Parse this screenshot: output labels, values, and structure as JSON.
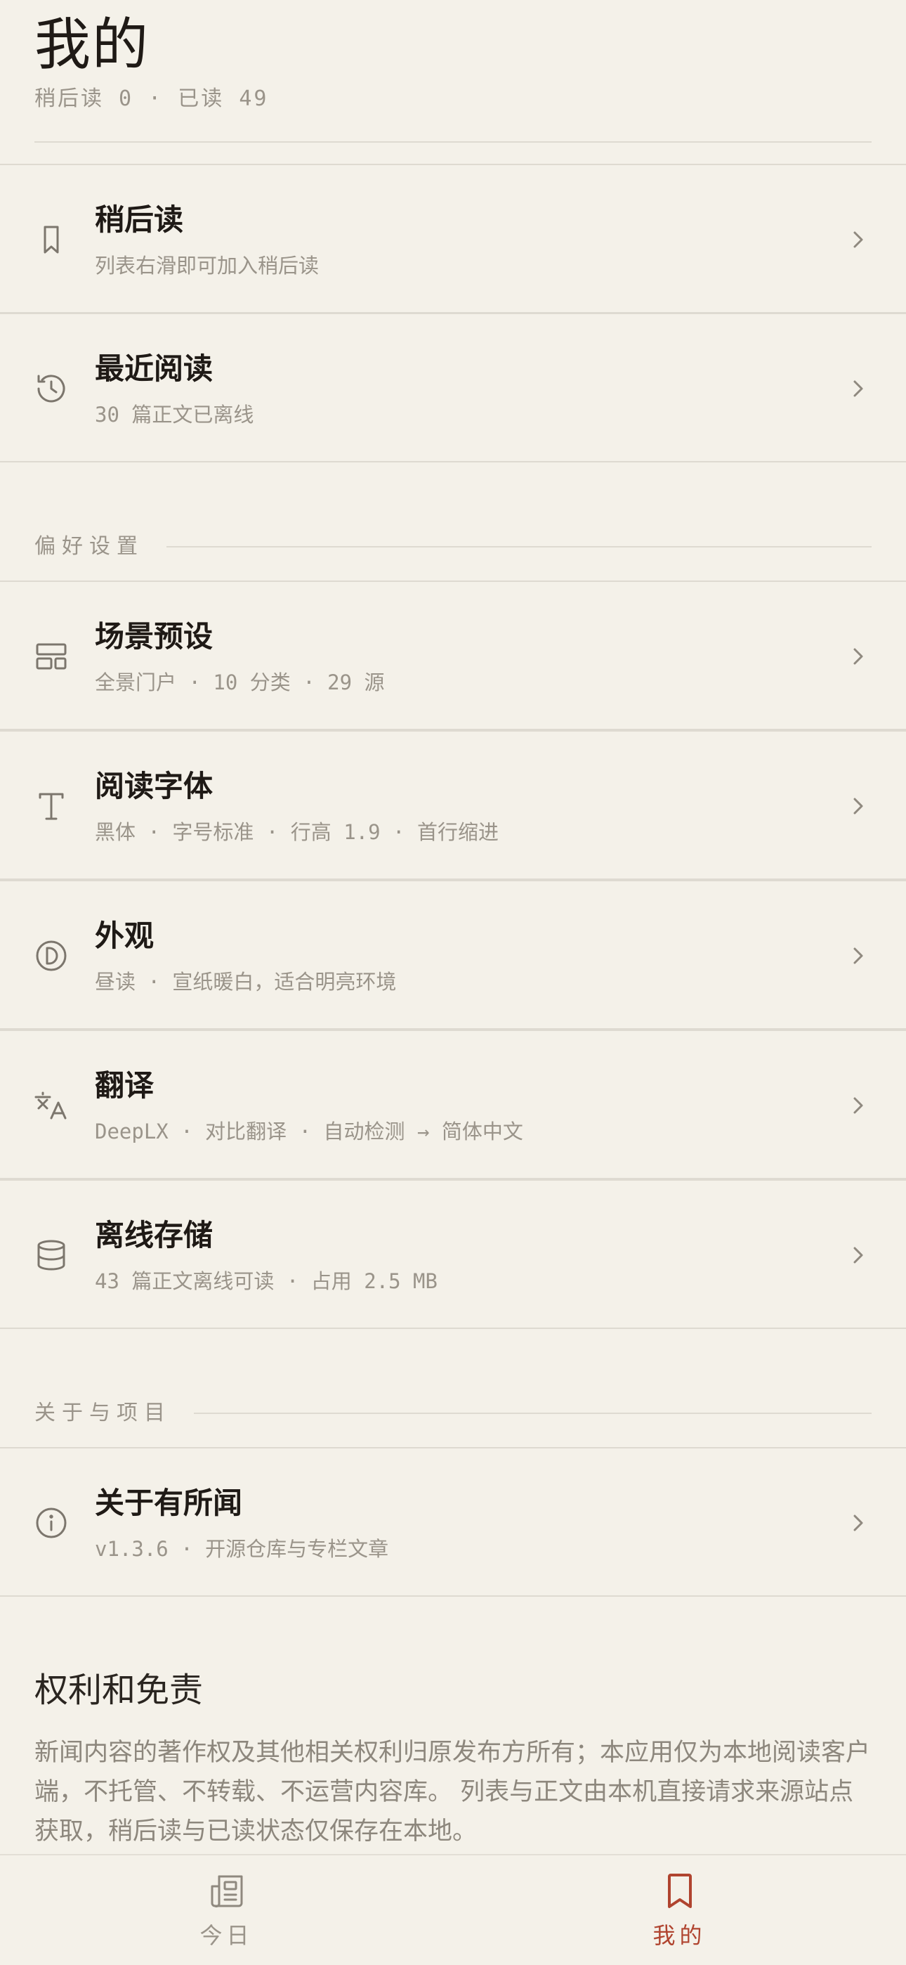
{
  "header": {
    "title": "我的",
    "stats": "稍后读 0 · 已读 49"
  },
  "reading": [
    {
      "icon": "bookmark-icon",
      "title": "稍后读",
      "subtitle": "列表右滑即可加入稍后读"
    },
    {
      "icon": "history-icon",
      "title": "最近阅读",
      "subtitle": "30 篇正文已离线"
    }
  ],
  "preferences": {
    "heading": "偏好设置",
    "items": [
      {
        "icon": "layout-icon",
        "title": "场景预设",
        "subtitle": "全景门户 · 10 分类 · 29 源"
      },
      {
        "icon": "type-icon",
        "title": "阅读字体",
        "subtitle": "黑体 · 字号标准 · 行高 1.9 · 首行缩进"
      },
      {
        "icon": "appearance-icon",
        "title": "外观",
        "subtitle": "昼读 · 宣纸暖白，适合明亮环境"
      },
      {
        "icon": "translate-icon",
        "title": "翻译",
        "subtitle": "DeepLX · 对比翻译 · 自动检测 → 简体中文"
      },
      {
        "icon": "database-icon",
        "title": "离线存储",
        "subtitle": "43 篇正文离线可读 · 占用 2.5 MB"
      }
    ]
  },
  "about": {
    "heading": "关于与项目",
    "items": [
      {
        "icon": "info-icon",
        "title": "关于有所闻",
        "subtitle": "v1.3.6 · 开源仓库与专栏文章"
      }
    ]
  },
  "rights": {
    "title": "权利和免责",
    "body": "新闻内容的著作权及其他相关权利归原发布方所有；本应用仅为本地阅读客户端，不托管、不转载、不运营内容库。 列表与正文由本机直接请求来源站点获取，稍后读与已读状态仅保存在本地。"
  },
  "tabbar": {
    "tabs": [
      {
        "label": "今日",
        "icon": "newspaper-icon",
        "active": false
      },
      {
        "label": "我的",
        "icon": "bookmark-icon",
        "active": true
      }
    ]
  },
  "colors": {
    "background": "#f4f1e9",
    "accent": "#b0442f",
    "muted_text": "#9a948a",
    "divider": "#dedad1"
  }
}
